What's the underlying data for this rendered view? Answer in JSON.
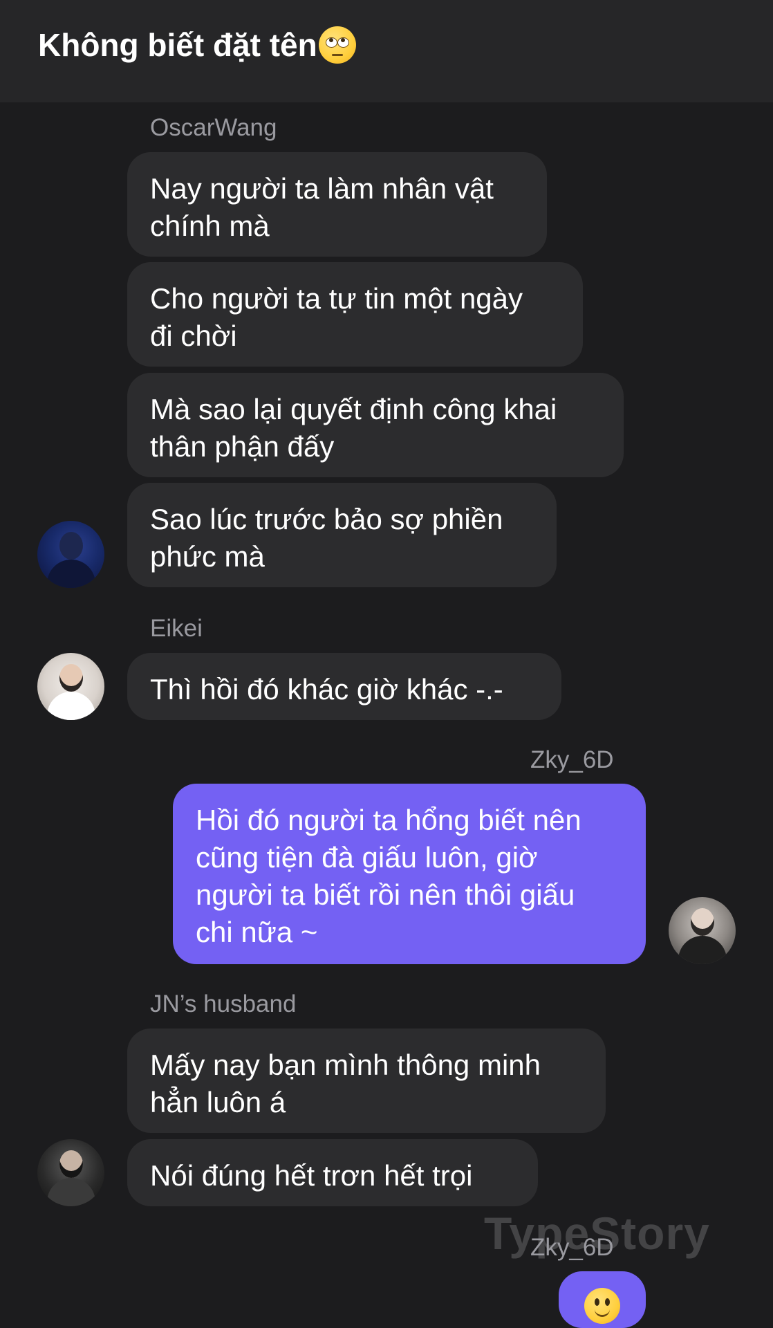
{
  "header": {
    "title": "Không biết đặt tên"
  },
  "messages": [
    {
      "sender": "OscarWang",
      "lines": [
        "Nay người ta làm nhân vật",
        "chính mà"
      ]
    },
    {
      "lines": [
        "Cho người ta tự tin một ngày",
        "đi chời"
      ]
    },
    {
      "lines": [
        "Mà sao lại quyết định công khai",
        "thân phận đấy"
      ]
    },
    {
      "lines": [
        "Sao lúc trước bảo sợ phiền",
        "phức mà"
      ]
    },
    {
      "sender": "Eikei",
      "lines": [
        "Thì hồi đó khác giờ khác -.-"
      ]
    },
    {
      "sender": "Zky_6D",
      "lines": [
        "Hồi đó người ta hổng biết nên",
        "cũng tiện đà giấu luôn, giờ",
        "người ta biết rồi nên thôi giấu",
        "chi nữa ~"
      ]
    },
    {
      "sender": "JN’s husband",
      "lines": [
        "Mấy nay bạn mình thông minh",
        "hẳn luôn á"
      ]
    },
    {
      "lines": [
        "Nói đúng hết trơn hết trọi"
      ]
    },
    {
      "sender": "Zky_6D",
      "emoji": "slightly-smiling-face-emoji"
    }
  ],
  "watermark": "TypeStory",
  "icons": {
    "title_emoji": "face-with-rolling-eyes-emoji",
    "last_emoji": "slightly-smiling-face-emoji"
  },
  "colors": {
    "background": "#1c1c1e",
    "header": "#262628",
    "bubble_other": "#2c2c2e",
    "bubble_mine": "#7461f3",
    "sender_name": "#9a9aa0"
  }
}
